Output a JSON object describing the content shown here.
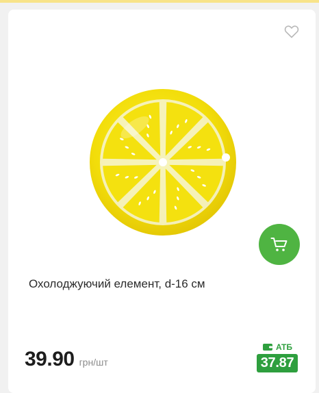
{
  "product": {
    "name": "Охолоджуючий елемент, d-16 см",
    "price": "39.90",
    "unit": "грн/шт",
    "promo_label": "АТБ",
    "promo_price": "37.87"
  },
  "icons": {
    "favorite": "heart-outline-icon",
    "cart": "shopping-cart-icon",
    "promo": "wallet-icon"
  },
  "colors": {
    "accent_green": "#4fb442",
    "promo_green": "#2e9f3e",
    "lemon_yellow": "#f3e10d"
  }
}
